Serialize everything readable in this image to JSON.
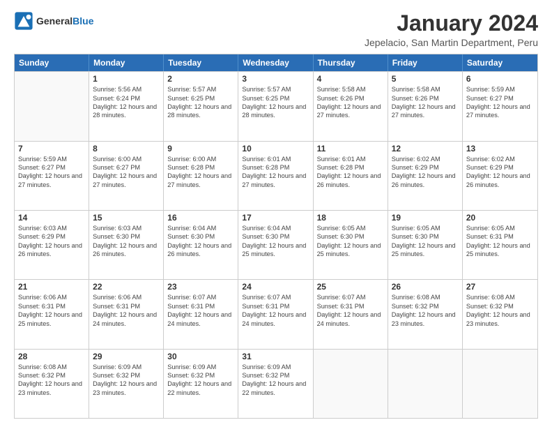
{
  "logo": {
    "general": "General",
    "blue": "Blue"
  },
  "title": "January 2024",
  "subtitle": "Jepelacio, San Martin Department, Peru",
  "days_header": [
    "Sunday",
    "Monday",
    "Tuesday",
    "Wednesday",
    "Thursday",
    "Friday",
    "Saturday"
  ],
  "weeks": [
    [
      {
        "day": "",
        "sunrise": "",
        "sunset": "",
        "daylight": ""
      },
      {
        "day": "1",
        "sunrise": "Sunrise: 5:56 AM",
        "sunset": "Sunset: 6:24 PM",
        "daylight": "Daylight: 12 hours and 28 minutes."
      },
      {
        "day": "2",
        "sunrise": "Sunrise: 5:57 AM",
        "sunset": "Sunset: 6:25 PM",
        "daylight": "Daylight: 12 hours and 28 minutes."
      },
      {
        "day": "3",
        "sunrise": "Sunrise: 5:57 AM",
        "sunset": "Sunset: 6:25 PM",
        "daylight": "Daylight: 12 hours and 28 minutes."
      },
      {
        "day": "4",
        "sunrise": "Sunrise: 5:58 AM",
        "sunset": "Sunset: 6:26 PM",
        "daylight": "Daylight: 12 hours and 27 minutes."
      },
      {
        "day": "5",
        "sunrise": "Sunrise: 5:58 AM",
        "sunset": "Sunset: 6:26 PM",
        "daylight": "Daylight: 12 hours and 27 minutes."
      },
      {
        "day": "6",
        "sunrise": "Sunrise: 5:59 AM",
        "sunset": "Sunset: 6:27 PM",
        "daylight": "Daylight: 12 hours and 27 minutes."
      }
    ],
    [
      {
        "day": "7",
        "sunrise": "Sunrise: 5:59 AM",
        "sunset": "Sunset: 6:27 PM",
        "daylight": "Daylight: 12 hours and 27 minutes."
      },
      {
        "day": "8",
        "sunrise": "Sunrise: 6:00 AM",
        "sunset": "Sunset: 6:27 PM",
        "daylight": "Daylight: 12 hours and 27 minutes."
      },
      {
        "day": "9",
        "sunrise": "Sunrise: 6:00 AM",
        "sunset": "Sunset: 6:28 PM",
        "daylight": "Daylight: 12 hours and 27 minutes."
      },
      {
        "day": "10",
        "sunrise": "Sunrise: 6:01 AM",
        "sunset": "Sunset: 6:28 PM",
        "daylight": "Daylight: 12 hours and 27 minutes."
      },
      {
        "day": "11",
        "sunrise": "Sunrise: 6:01 AM",
        "sunset": "Sunset: 6:28 PM",
        "daylight": "Daylight: 12 hours and 26 minutes."
      },
      {
        "day": "12",
        "sunrise": "Sunrise: 6:02 AM",
        "sunset": "Sunset: 6:29 PM",
        "daylight": "Daylight: 12 hours and 26 minutes."
      },
      {
        "day": "13",
        "sunrise": "Sunrise: 6:02 AM",
        "sunset": "Sunset: 6:29 PM",
        "daylight": "Daylight: 12 hours and 26 minutes."
      }
    ],
    [
      {
        "day": "14",
        "sunrise": "Sunrise: 6:03 AM",
        "sunset": "Sunset: 6:29 PM",
        "daylight": "Daylight: 12 hours and 26 minutes."
      },
      {
        "day": "15",
        "sunrise": "Sunrise: 6:03 AM",
        "sunset": "Sunset: 6:30 PM",
        "daylight": "Daylight: 12 hours and 26 minutes."
      },
      {
        "day": "16",
        "sunrise": "Sunrise: 6:04 AM",
        "sunset": "Sunset: 6:30 PM",
        "daylight": "Daylight: 12 hours and 26 minutes."
      },
      {
        "day": "17",
        "sunrise": "Sunrise: 6:04 AM",
        "sunset": "Sunset: 6:30 PM",
        "daylight": "Daylight: 12 hours and 25 minutes."
      },
      {
        "day": "18",
        "sunrise": "Sunrise: 6:05 AM",
        "sunset": "Sunset: 6:30 PM",
        "daylight": "Daylight: 12 hours and 25 minutes."
      },
      {
        "day": "19",
        "sunrise": "Sunrise: 6:05 AM",
        "sunset": "Sunset: 6:30 PM",
        "daylight": "Daylight: 12 hours and 25 minutes."
      },
      {
        "day": "20",
        "sunrise": "Sunrise: 6:05 AM",
        "sunset": "Sunset: 6:31 PM",
        "daylight": "Daylight: 12 hours and 25 minutes."
      }
    ],
    [
      {
        "day": "21",
        "sunrise": "Sunrise: 6:06 AM",
        "sunset": "Sunset: 6:31 PM",
        "daylight": "Daylight: 12 hours and 25 minutes."
      },
      {
        "day": "22",
        "sunrise": "Sunrise: 6:06 AM",
        "sunset": "Sunset: 6:31 PM",
        "daylight": "Daylight: 12 hours and 24 minutes."
      },
      {
        "day": "23",
        "sunrise": "Sunrise: 6:07 AM",
        "sunset": "Sunset: 6:31 PM",
        "daylight": "Daylight: 12 hours and 24 minutes."
      },
      {
        "day": "24",
        "sunrise": "Sunrise: 6:07 AM",
        "sunset": "Sunset: 6:31 PM",
        "daylight": "Daylight: 12 hours and 24 minutes."
      },
      {
        "day": "25",
        "sunrise": "Sunrise: 6:07 AM",
        "sunset": "Sunset: 6:31 PM",
        "daylight": "Daylight: 12 hours and 24 minutes."
      },
      {
        "day": "26",
        "sunrise": "Sunrise: 6:08 AM",
        "sunset": "Sunset: 6:32 PM",
        "daylight": "Daylight: 12 hours and 23 minutes."
      },
      {
        "day": "27",
        "sunrise": "Sunrise: 6:08 AM",
        "sunset": "Sunset: 6:32 PM",
        "daylight": "Daylight: 12 hours and 23 minutes."
      }
    ],
    [
      {
        "day": "28",
        "sunrise": "Sunrise: 6:08 AM",
        "sunset": "Sunset: 6:32 PM",
        "daylight": "Daylight: 12 hours and 23 minutes."
      },
      {
        "day": "29",
        "sunrise": "Sunrise: 6:09 AM",
        "sunset": "Sunset: 6:32 PM",
        "daylight": "Daylight: 12 hours and 23 minutes."
      },
      {
        "day": "30",
        "sunrise": "Sunrise: 6:09 AM",
        "sunset": "Sunset: 6:32 PM",
        "daylight": "Daylight: 12 hours and 22 minutes."
      },
      {
        "day": "31",
        "sunrise": "Sunrise: 6:09 AM",
        "sunset": "Sunset: 6:32 PM",
        "daylight": "Daylight: 12 hours and 22 minutes."
      },
      {
        "day": "",
        "sunrise": "",
        "sunset": "",
        "daylight": ""
      },
      {
        "day": "",
        "sunrise": "",
        "sunset": "",
        "daylight": ""
      },
      {
        "day": "",
        "sunrise": "",
        "sunset": "",
        "daylight": ""
      }
    ]
  ]
}
